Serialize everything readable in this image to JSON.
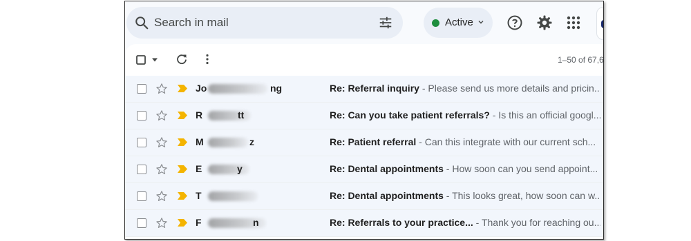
{
  "search": {
    "placeholder": "Search in mail"
  },
  "status": {
    "label": "Active",
    "dot_color": "#1e8e3e"
  },
  "toolbar": {
    "pagination": "1–50 of 67,6"
  },
  "emails": [
    {
      "sender_start": "Jo",
      "sender_end": "ng",
      "subject": "Re: Referral inquiry",
      "snippet": " - Please send us more details and pricin..."
    },
    {
      "sender_start": "R",
      "sender_end": "tt",
      "subject": "Re: Can you take patient referrals?",
      "snippet": " - Is this an official googl..."
    },
    {
      "sender_start": "M",
      "sender_end": "z",
      "subject": "Re: Patient referral",
      "snippet": " - Can this integrate with our current sch..."
    },
    {
      "sender_start": "E",
      "sender_end": "y",
      "subject": "Re: Dental appointments",
      "snippet": " - How soon can you send appoint..."
    },
    {
      "sender_start": "T",
      "sender_end": "",
      "subject": "Re: Dental appointments",
      "snippet": " - This looks great, how soon can w..."
    },
    {
      "sender_start": "F",
      "sender_end": "n",
      "subject": "Re: Referrals to your practice...",
      "snippet": " - Thank you for reaching ou..."
    }
  ],
  "icons": [
    "search-icon",
    "tune-icon",
    "chevron-down-icon",
    "help-icon",
    "gear-icon",
    "apps-grid-icon",
    "checkbox-icon",
    "refresh-icon",
    "more-vert-icon",
    "star-icon",
    "important-marker-icon"
  ],
  "colors": {
    "important_marker": "#f4b400",
    "search_bg": "#e9eef6",
    "row_bg": "#f2f6fc"
  }
}
